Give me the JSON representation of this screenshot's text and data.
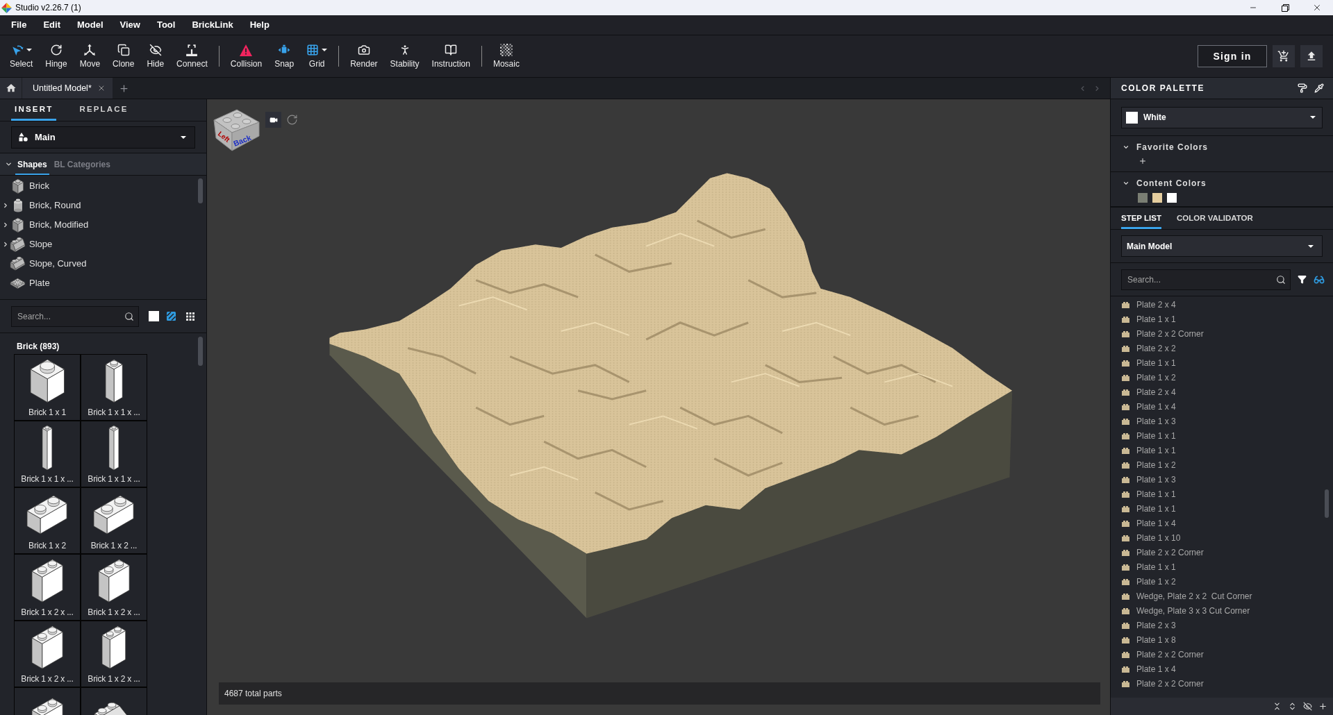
{
  "window": {
    "title": "Studio v2.26.7 (1)"
  },
  "menu": [
    "File",
    "Edit",
    "Model",
    "View",
    "Tool",
    "BrickLink",
    "Help"
  ],
  "toolbar": {
    "groups": [
      [
        {
          "label": "Select",
          "kind": "select",
          "active": true,
          "dropdown": true
        },
        {
          "label": "Hinge",
          "kind": "hinge",
          "active": false,
          "dropdown": false
        },
        {
          "label": "Move",
          "kind": "move",
          "active": false,
          "dropdown": false
        },
        {
          "label": "Clone",
          "kind": "clone",
          "active": false,
          "dropdown": false
        },
        {
          "label": "Hide",
          "kind": "hide",
          "active": false,
          "dropdown": false
        },
        {
          "label": "Connect",
          "kind": "connect",
          "active": false,
          "dropdown": false
        }
      ],
      [
        {
          "label": "Collision",
          "kind": "collision",
          "active": true,
          "dropdown": false
        },
        {
          "label": "Snap",
          "kind": "snap",
          "active": true,
          "dropdown": false
        },
        {
          "label": "Grid",
          "kind": "grid",
          "active": true,
          "dropdown": true
        }
      ],
      [
        {
          "label": "Render",
          "kind": "render",
          "active": false,
          "dropdown": false
        },
        {
          "label": "Stability",
          "kind": "stability",
          "active": false,
          "dropdown": false
        },
        {
          "label": "Instruction",
          "kind": "instruction",
          "active": false,
          "dropdown": false
        }
      ],
      [
        {
          "label": "Mosaic",
          "kind": "mosaic",
          "active": false,
          "dropdown": false
        }
      ]
    ],
    "sign_in": "Sign in"
  },
  "document_tabs": [
    {
      "label": "Untitled Model*",
      "selected": true
    }
  ],
  "left_panel": {
    "tabs": [
      {
        "label": "INSERT",
        "selected": true
      },
      {
        "label": "REPLACE",
        "selected": false
      }
    ],
    "palette": {
      "value": "Main"
    },
    "category_row": {
      "expanded": true,
      "tabs": [
        {
          "label": "Shapes",
          "selected": true
        },
        {
          "label": "BL Categories",
          "selected": false
        }
      ]
    },
    "shapes": [
      {
        "label": "Brick",
        "kind": "brick",
        "expandable": false
      },
      {
        "label": "Brick, Round",
        "kind": "round",
        "expandable": true
      },
      {
        "label": "Brick, Modified",
        "kind": "modified",
        "expandable": true
      },
      {
        "label": "Slope",
        "kind": "slope",
        "expandable": true
      },
      {
        "label": "Slope, Curved",
        "kind": "curved",
        "expandable": false
      },
      {
        "label": "Plate",
        "kind": "plate",
        "expandable": false
      }
    ],
    "search": {
      "placeholder": "Search..."
    },
    "color_swatch": {
      "color": "#ffffff"
    },
    "view_toggles": [
      {
        "kind": "pattern",
        "on": true
      },
      {
        "kind": "grid",
        "on": false
      }
    ],
    "parts_heading": "Brick (893)",
    "parts": [
      {
        "label": "Brick 1 x 1",
        "kind": "cube"
      },
      {
        "label": "Brick 1 x 1 x ...",
        "kind": "pillar"
      },
      {
        "label": "Brick 1 x 1 x ...",
        "kind": "slim"
      },
      {
        "label": "Brick 1 x 1 x ...",
        "kind": "slim"
      },
      {
        "label": "Brick 1 x 2",
        "kind": "brick"
      },
      {
        "label": "Brick 1 x 2 ...",
        "kind": "brick"
      },
      {
        "label": "Brick 1 x 2 x ...",
        "kind": "block"
      },
      {
        "label": "Brick 1 x 2 x ...",
        "kind": "block"
      },
      {
        "label": "Brick 1 x 2 x ...",
        "kind": "block"
      },
      {
        "label": "Brick 1 x 2 x ...",
        "kind": "tall"
      },
      {
        "kind": "block"
      },
      {
        "kind": "slope"
      }
    ]
  },
  "viewport": {
    "view_cube": {
      "labels": [
        "Left",
        "Back"
      ]
    },
    "status": "4687 total parts"
  },
  "color_palette": {
    "title": "COLOR PALETTE",
    "selected_color": {
      "name": "White",
      "color": "#ffffff"
    },
    "favorite_colors": {
      "title": "Favorite Colors",
      "expanded": true
    },
    "content_colors": {
      "title": "Content Colors",
      "expanded": true,
      "swatches": [
        {
          "color": "#7a7e73"
        },
        {
          "color": "#e4cd9e"
        },
        {
          "color": "#ffffff"
        }
      ]
    }
  },
  "steps_panel": {
    "tabs": [
      {
        "label": "STEP LIST",
        "selected": true
      },
      {
        "label": "COLOR VALIDATOR",
        "selected": false
      }
    ],
    "model": {
      "value": "Main Model"
    },
    "search": {
      "placeholder": "Search..."
    },
    "steps": [
      {
        "label": "Plate 2 x 4"
      },
      {
        "label": "Plate 1 x 1"
      },
      {
        "label": "Plate 2 x 2 Corner"
      },
      {
        "label": "Plate 2 x 2"
      },
      {
        "label": "Plate 1 x 1"
      },
      {
        "label": "Plate 1 x 2"
      },
      {
        "label": "Plate 2 x 4"
      },
      {
        "label": "Plate 1 x 4"
      },
      {
        "label": "Plate 1 x 3"
      },
      {
        "label": "Plate 1 x 1"
      },
      {
        "label": "Plate 1 x 1"
      },
      {
        "label": "Plate 1 x 2"
      },
      {
        "label": "Plate 1 x 3"
      },
      {
        "label": "Plate 1 x 1"
      },
      {
        "label": "Plate 1 x 1"
      },
      {
        "label": "Plate 1 x 4"
      },
      {
        "label": "Plate 1 x 10"
      },
      {
        "label": "Plate 2 x 2 Corner"
      },
      {
        "label": "Plate 1 x 1"
      },
      {
        "label": "Plate 1 x 2"
      },
      {
        "label": "Wedge, Plate 2 x 2  Cut Corner"
      },
      {
        "label": "Wedge, Plate 3 x 3 Cut Corner"
      },
      {
        "label": "Plate 2 x 3"
      },
      {
        "label": "Plate 1 x 8"
      },
      {
        "label": "Plate 2 x 2 Corner"
      },
      {
        "label": "Plate 1 x 4"
      },
      {
        "label": "Plate 2 x 2 Corner"
      }
    ]
  }
}
